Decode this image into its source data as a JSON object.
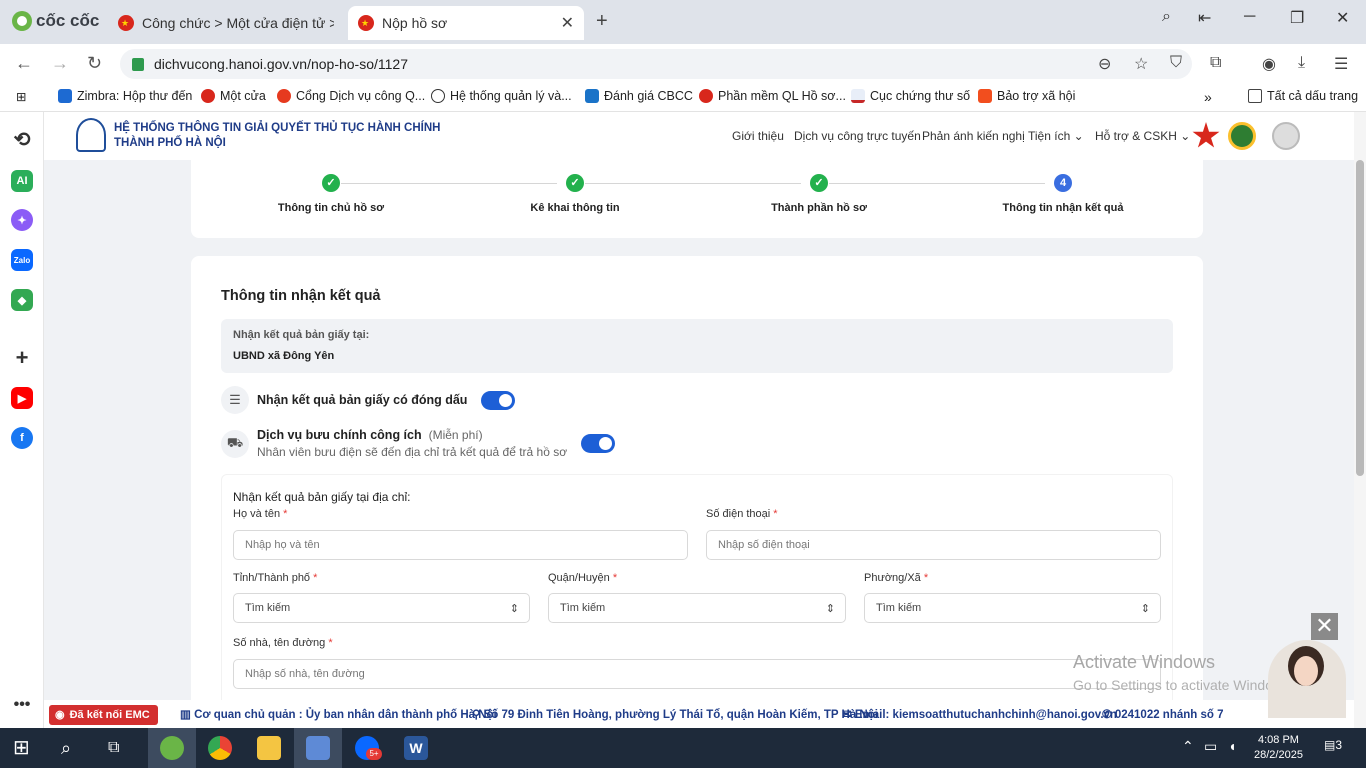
{
  "browser": {
    "brand": "cốc cốc",
    "tabs": [
      {
        "title": "Công chức > Một cửa điện tử > Tr"
      },
      {
        "title": "Nộp hồ sơ"
      }
    ],
    "url": "dichvucong.hanoi.gov.vn/nop-ho-so/1127",
    "bookmarks": [
      {
        "label": "Zimbra: Hộp thư đến"
      },
      {
        "label": "Một cửa"
      },
      {
        "label": "Cổng Dịch vụ công Q..."
      },
      {
        "label": "Hệ thống quản lý và..."
      },
      {
        "label": "Đánh giá CBCC"
      },
      {
        "label": "Phần mềm QL Hồ sơ..."
      },
      {
        "label": "Cục chứng thư số"
      },
      {
        "label": "Bảo trợ xã hội"
      }
    ],
    "all_bookmarks": "Tất cả dấu trang"
  },
  "site": {
    "title_line1": "HỆ THỐNG THÔNG TIN GIẢI QUYẾT THỦ TỤC HÀNH CHÍNH",
    "title_line2": "THÀNH PHỐ HÀ NỘI",
    "menu": [
      "Giới thiệu",
      "Dịch vụ công trực tuyến",
      "Phản ánh kiến nghị",
      "Tiện ích",
      "Hỗ trợ & CSKH"
    ]
  },
  "steps": [
    {
      "label": "Thông tin chủ hồ sơ",
      "status": "done"
    },
    {
      "label": "Kê khai thông tin",
      "status": "done"
    },
    {
      "label": "Thành phần hồ sơ",
      "status": "done"
    },
    {
      "label": "Thông tin nhận kết quả",
      "status": "current",
      "number": "4"
    }
  ],
  "form": {
    "title": "Thông tin nhận kết quả",
    "paper_at_label": "Nhận kết quả bản giấy tại:",
    "paper_at_value": "UBND xã Đông Yên",
    "stamped_label": "Nhận kết quả bản giấy có đóng dấu",
    "stamped_on": true,
    "postal_label": "Dịch vụ bưu chính công ích",
    "postal_free": "(Miễn phí)",
    "postal_desc": "Nhân viên bưu điện sẽ đến địa chỉ trả kết quả để trả hồ sơ",
    "postal_on": true,
    "address_heading": "Nhận kết quả bản giấy tại địa chỉ:",
    "name_label": "Họ và tên",
    "name_placeholder": "Nhập họ và tên",
    "phone_label": "Số điện thoại",
    "phone_placeholder": "Nhập số điện thoại",
    "province_label": "Tỉnh/Thành phố",
    "district_label": "Quận/Huyện",
    "ward_label": "Phường/Xã",
    "search_placeholder": "Tìm kiếm",
    "street_label": "Số nhà, tên đường",
    "street_placeholder": "Nhập số nhà, tên đường",
    "required_mark": "*"
  },
  "footer": {
    "emc": "Đã kết nối EMC",
    "agency": "Cơ quan chủ quản : Ủy ban nhân dân thành phố Hà Nội",
    "address": "Số 79 Đinh Tiên Hoàng, phường Lý Thái Tổ, quận Hoàn Kiếm, TP Hà Nội",
    "email": "Email: kiemsoatthutuchanhchinh@hanoi.gov.vn",
    "phone": "0241022 nhánh số 7"
  },
  "watermark": {
    "line1": "Activate Windows",
    "line2": "Go to Settings to activate Windo"
  },
  "taskbar": {
    "time": "4:08 PM",
    "date": "28/2/2025",
    "notifications": "3",
    "zalo_badge": "5+"
  }
}
